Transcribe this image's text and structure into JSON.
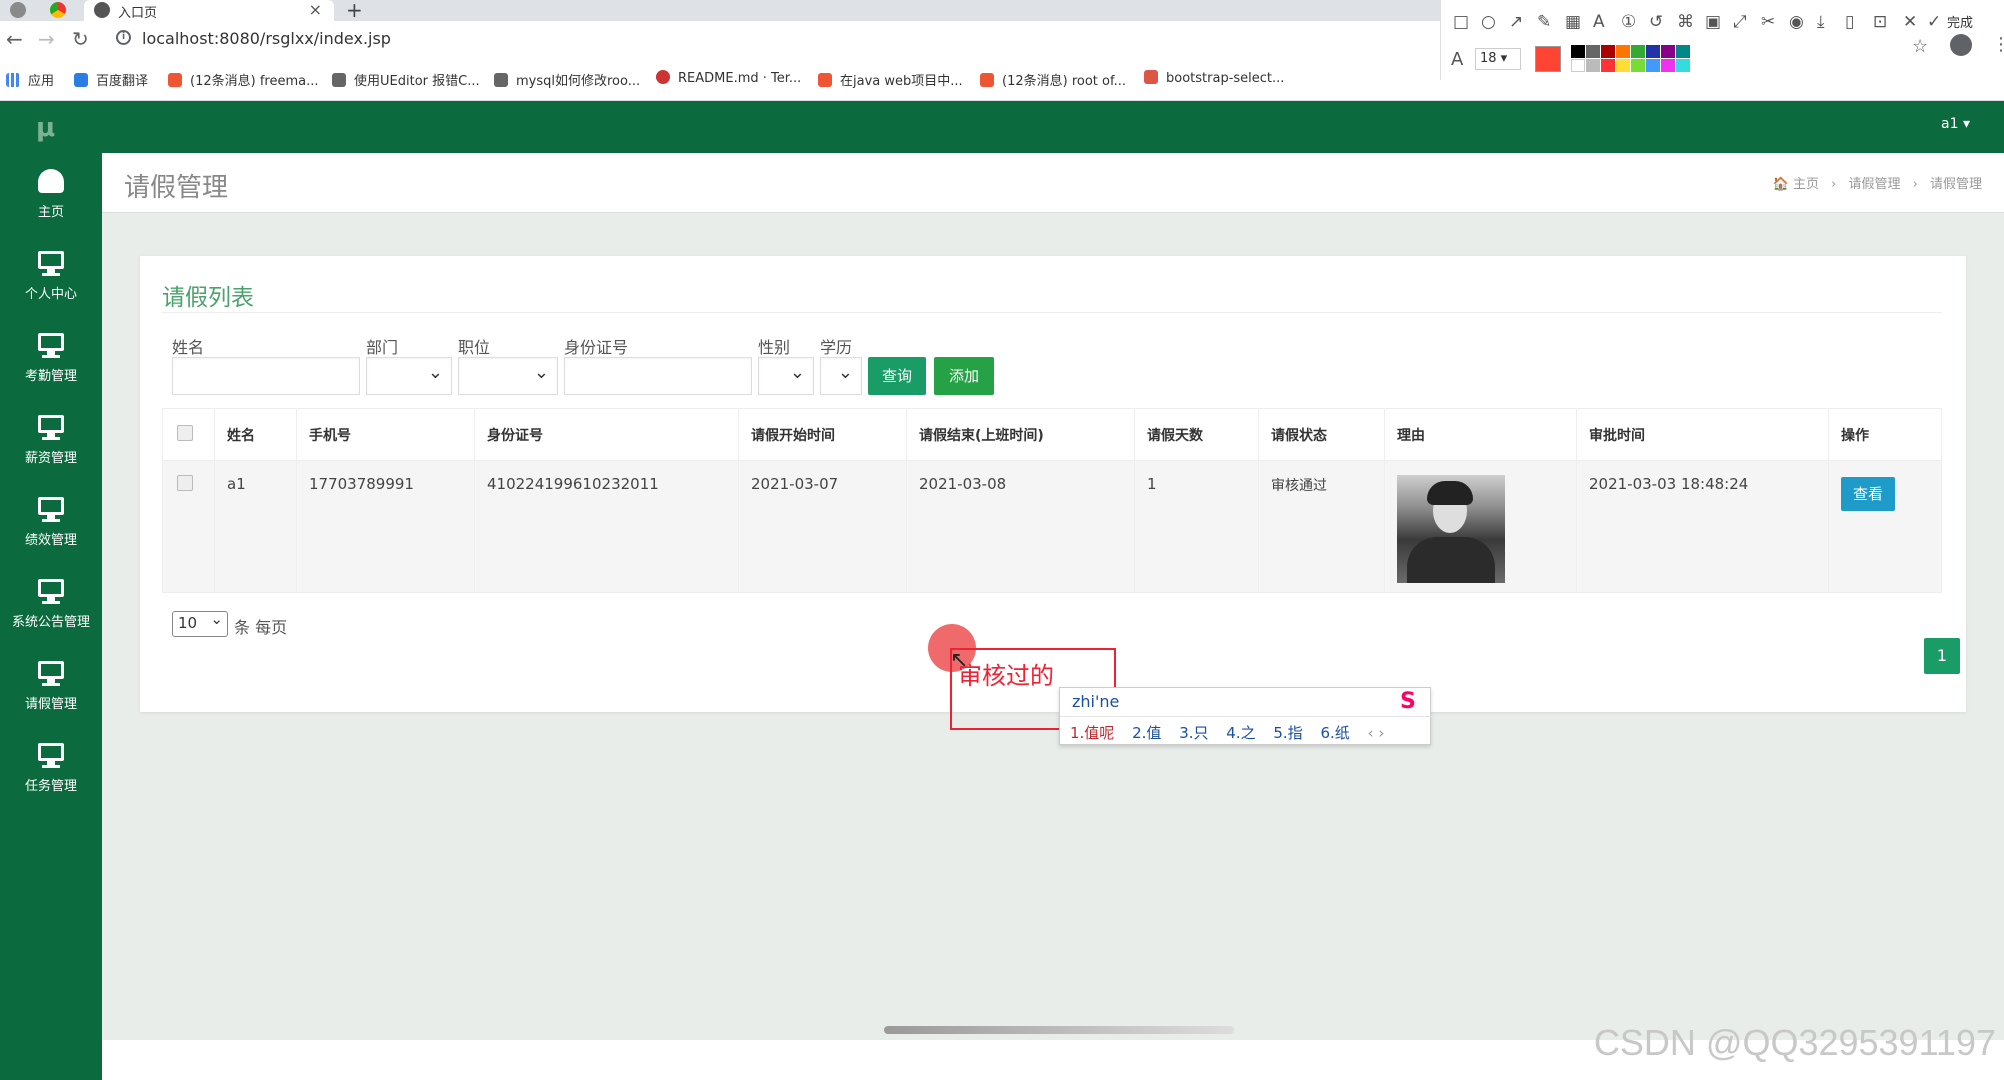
{
  "browser": {
    "tab_title": "入口页",
    "url": "localhost:8080/rsglxx/index.jsp",
    "bookmarks": [
      "应用",
      "百度翻译",
      "(12条消息) freema...",
      "使用UEditor 报错C...",
      "mysql如何修改roo...",
      "README.md · Ter...",
      "在java web项目中...",
      "(12条消息) root of...",
      "bootstrap-select..."
    ]
  },
  "snaptool": {
    "done_label": "完成",
    "font_size": "18"
  },
  "header": {
    "logo": "μ",
    "user": "a1 ▾"
  },
  "sidebar": {
    "items": [
      {
        "label": "主页",
        "icon": "dashboard-icon"
      },
      {
        "label": "个人中心",
        "icon": "monitor-icon"
      },
      {
        "label": "考勤管理",
        "icon": "monitor-icon"
      },
      {
        "label": "薪资管理",
        "icon": "monitor-icon"
      },
      {
        "label": "绩效管理",
        "icon": "monitor-icon"
      },
      {
        "label": "系统公告管理",
        "icon": "monitor-icon"
      },
      {
        "label": "请假管理",
        "icon": "monitor-icon"
      },
      {
        "label": "任务管理",
        "icon": "monitor-icon"
      }
    ]
  },
  "page": {
    "title": "请假管理",
    "breadcrumb": [
      "🏠 主页",
      "›",
      "请假管理",
      "›",
      "请假管理"
    ]
  },
  "panel": {
    "title": "请假列表",
    "filters": {
      "name_label": "姓名",
      "dept_label": "部门",
      "position_label": "职位",
      "idcard_label": "身份证号",
      "gender_label": "性别",
      "education_label": "学历"
    },
    "query_btn": "查询",
    "add_btn": "添加",
    "table": {
      "headers": [
        "姓名",
        "手机号",
        "身份证号",
        "请假开始时间",
        "请假结束(上班时间)",
        "请假天数",
        "请假状态",
        "理由",
        "审批时间",
        "操作"
      ],
      "rows": [
        {
          "name": "a1",
          "phone": "17703789991",
          "idcard": "410224199610232011",
          "start": "2021-03-07",
          "end": "2021-03-08",
          "days": "1",
          "status": "审核通过",
          "approve_time": "2021-03-03 18:48:24",
          "action": "查看"
        }
      ]
    },
    "page_size": "10",
    "page_size_suffix": "条 每页",
    "current_page": "1"
  },
  "annotation": {
    "text": "审核过的",
    "ime_input": "zhi'ne",
    "ime_candidates": [
      "1.值呢",
      "2.值",
      "3.只",
      "4.之",
      "5.指",
      "6.纸"
    ]
  },
  "watermark": "CSDN @QQ3295391197",
  "colors": {
    "brand_green": "#0b6b3e",
    "accent_green": "#1a9c66",
    "info_blue": "#1e9bc9"
  }
}
